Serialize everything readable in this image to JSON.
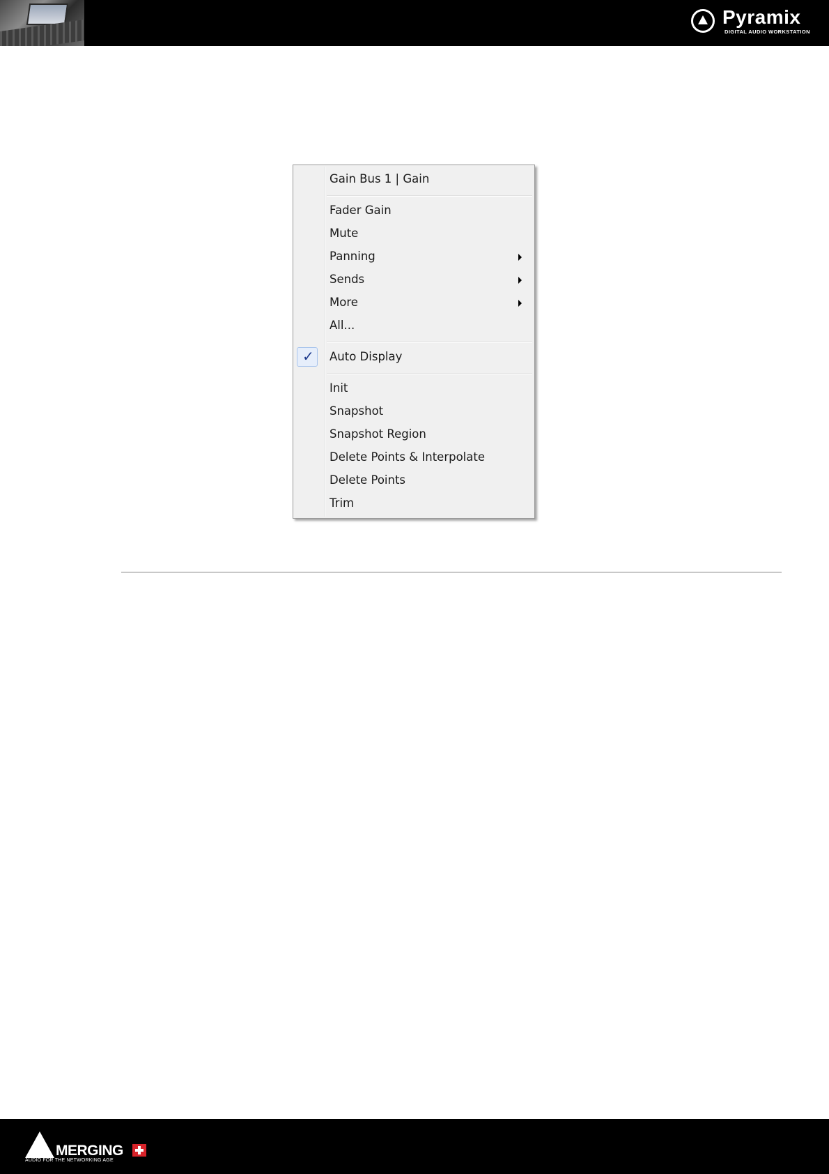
{
  "header": {
    "brand_name": "Pyramix",
    "brand_tagline": "DIGITAL AUDIO WORKSTATION",
    "icons": [
      "header-photo",
      "pyramix-logo-icon"
    ]
  },
  "menu": {
    "title": "Gain Bus 1 | Gain",
    "items": [
      {
        "label": "Fader Gain",
        "submenu": false
      },
      {
        "label": "Mute",
        "submenu": false
      },
      {
        "label": "Panning",
        "submenu": true
      },
      {
        "label": "Sends",
        "submenu": true
      },
      {
        "label": "More",
        "submenu": true
      },
      {
        "label": "All...",
        "submenu": false
      },
      {
        "label": "Auto Display",
        "checked": true
      },
      {
        "label": "Init",
        "submenu": false
      },
      {
        "label": "Snapshot",
        "submenu": false
      },
      {
        "label": "Snapshot Region",
        "submenu": false
      },
      {
        "label": "Delete Points & Interpolate",
        "submenu": false
      },
      {
        "label": "Delete Points",
        "submenu": false
      },
      {
        "label": "Trim",
        "submenu": false
      }
    ],
    "check_glyph": "✓",
    "icons": [
      "check-icon",
      "submenu-arrow-icon"
    ]
  },
  "footer": {
    "brand_name": "MERGING",
    "brand_tagline": "AUDIO FOR THE NETWORKING AGE",
    "icons": [
      "merging-logo-icon",
      "swiss-cross-icon"
    ]
  }
}
